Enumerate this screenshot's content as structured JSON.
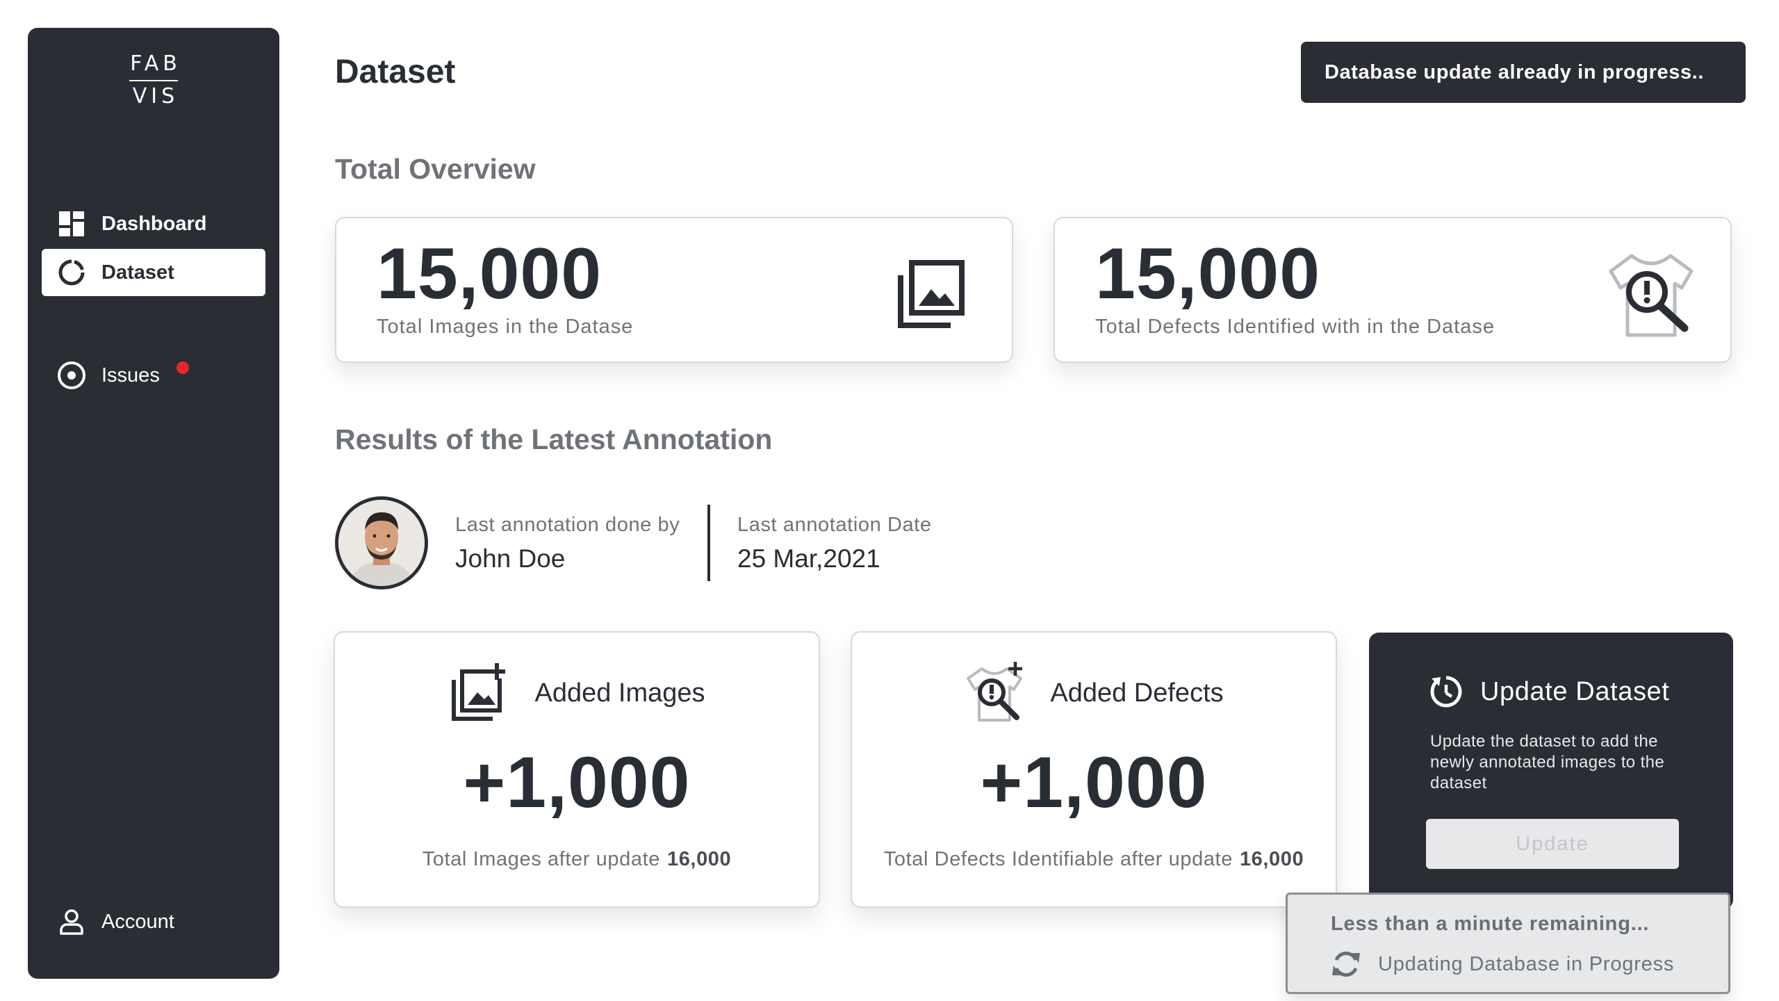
{
  "sidebar": {
    "logo_top": "FAB",
    "logo_bottom": "VIS",
    "items": [
      {
        "label": "Dashboard",
        "icon": "dashboard-icon",
        "active": false
      },
      {
        "label": "Dataset",
        "icon": "dataset-icon",
        "active": true
      },
      {
        "label": "Issues",
        "icon": "issues-icon",
        "active": false,
        "has_notification": true
      }
    ],
    "account": {
      "label": "Account",
      "icon": "user-icon"
    }
  },
  "header": {
    "title": "Dataset",
    "toast": "Database update already in progress.."
  },
  "overview": {
    "heading": "Total Overview",
    "images": {
      "value": "15,000",
      "label": "Total Images in the Datase",
      "icon": "images-icon"
    },
    "defects": {
      "value": "15,000",
      "label": "Total Defects Identified with in the Datase",
      "icon": "shirt-defect-search-icon"
    }
  },
  "annotation": {
    "heading": "Results of the Latest Annotation",
    "by_label": "Last annotation done by",
    "by_value": "John Doe",
    "date_label": "Last annotation Date",
    "date_value": "25 Mar,2021"
  },
  "added": {
    "images": {
      "title": "Added Images",
      "value": "+1,000",
      "footer_label": "Total Images after update",
      "footer_value": "16,000",
      "icon": "add-images-icon"
    },
    "defects": {
      "title": "Added Defects",
      "value": "+1,000",
      "footer_label": "Total Defects Identifiable after update",
      "footer_value": "16,000",
      "icon": "add-defect-icon"
    }
  },
  "update": {
    "title": "Update Dataset",
    "description": "Update the dataset to add the newly annotated images to the dataset",
    "button": "Update",
    "icon": "refresh-clock-icon"
  },
  "progress": {
    "title": "Less than a minute remaining...",
    "status": "Updating Database in Progress",
    "icon": "sync-icon"
  },
  "colors": {
    "dark": "#2a2d34",
    "muted_text": "#6f7377",
    "notification": "#e8262b",
    "disabled_button": "#e8e8ea"
  }
}
